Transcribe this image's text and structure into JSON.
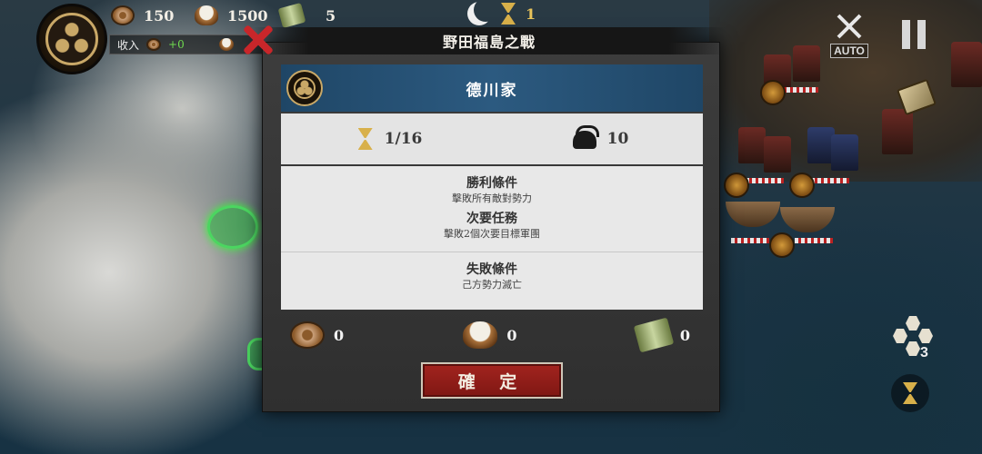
{
  "hud": {
    "coins": "150",
    "rice": "1500",
    "supplies": "5",
    "income_label": "收入",
    "income_coins": "+0",
    "turn": "1",
    "auto_label": "AUTO",
    "hex_count": "3"
  },
  "dialog": {
    "title": "野田福島之戰",
    "clan_name": "德川家",
    "turns": "1/16",
    "troops": "10",
    "victory_title": "勝利條件",
    "victory_desc": "擊敗所有敵對勢力",
    "secondary_title": "次要任務",
    "secondary_desc": "擊敗2個次要目標軍團",
    "defeat_title": "失敗條件",
    "defeat_desc": "己方勢力滅亡",
    "reward_coins": "0",
    "reward_rice": "0",
    "reward_supplies": "0",
    "confirm_label": "確 定"
  },
  "icons": {
    "coin": "coin-icon",
    "rice": "rice-icon",
    "supplies": "scroll-icon",
    "moon": "moon-icon",
    "hourglass": "hourglass-icon",
    "helmet": "helmet-icon",
    "close": "close-icon",
    "crest": "clan-crest-icon"
  },
  "colors": {
    "clan_header": "#2c5a80",
    "confirm_button": "#a3241f",
    "close": "#c8262a",
    "income_positive": "#6fdc4f",
    "turn_text": "#e8c35a"
  }
}
